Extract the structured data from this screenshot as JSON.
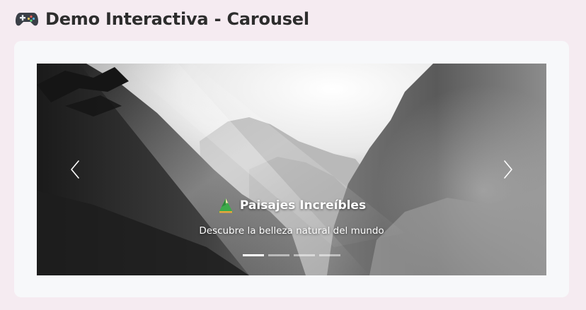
{
  "header": {
    "title": "Demo Interactiva - Carousel",
    "icon": "gamepad-icon"
  },
  "carousel": {
    "slides": [
      {
        "title": "Paisajes Increíbles",
        "subtitle": "Descubre la belleza natural del mundo",
        "icon": "mountain-icon",
        "image": "misty-forest-mountains-grayscale"
      }
    ],
    "active_index": 0,
    "indicator_count": 4,
    "prev_icon": "chevron-left-icon",
    "next_icon": "chevron-right-icon"
  },
  "colors": {
    "page_background": "#f5ebf1",
    "card_background": "#f7f8fa",
    "title_text": "#2d2d2d",
    "caption_text": "#ffffff"
  }
}
